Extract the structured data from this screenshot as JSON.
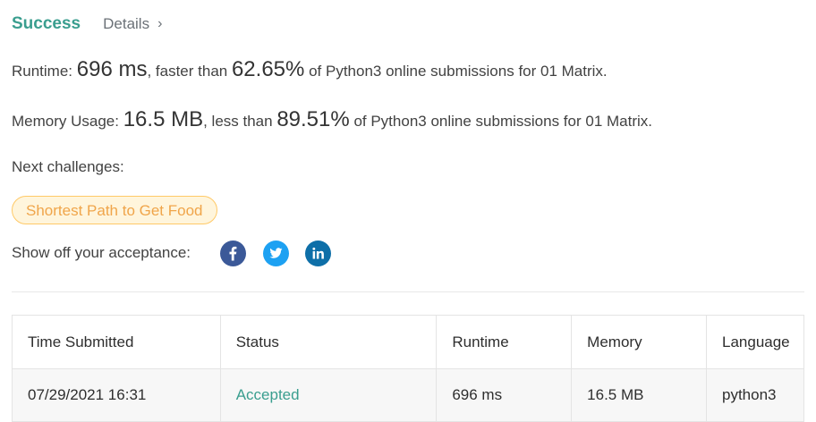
{
  "header": {
    "status": "Success",
    "details_label": "Details",
    "details_chevron": "›"
  },
  "runtime_line": {
    "label": "Runtime: ",
    "value": "696 ms",
    "middle": ", faster than ",
    "percent": "62.65%",
    "suffix": " of Python3 online submissions for 01 Matrix."
  },
  "memory_line": {
    "label": "Memory Usage: ",
    "value": "16.5 MB",
    "middle": ", less than ",
    "percent": "89.51%",
    "suffix": " of Python3 online submissions for 01 Matrix."
  },
  "next": {
    "label": "Next challenges:",
    "challenges": [
      "Shortest Path to Get Food"
    ]
  },
  "share": {
    "label": "Show off your acceptance:",
    "icons": [
      "facebook-icon",
      "twitter-icon",
      "linkedin-icon"
    ]
  },
  "table": {
    "headers": [
      "Time Submitted",
      "Status",
      "Runtime",
      "Memory",
      "Language"
    ],
    "rows": [
      {
        "time": "07/29/2021 16:31",
        "status": "Accepted",
        "runtime": "696 ms",
        "memory": "16.5 MB",
        "language": "python3"
      }
    ]
  },
  "colors": {
    "success": "#3a9e8f",
    "challenge_text": "#f0a54a",
    "challenge_bg": "#fff5dc",
    "facebook": "#3b5998",
    "twitter": "#1da1f2",
    "linkedin": "#0e6fa8"
  }
}
